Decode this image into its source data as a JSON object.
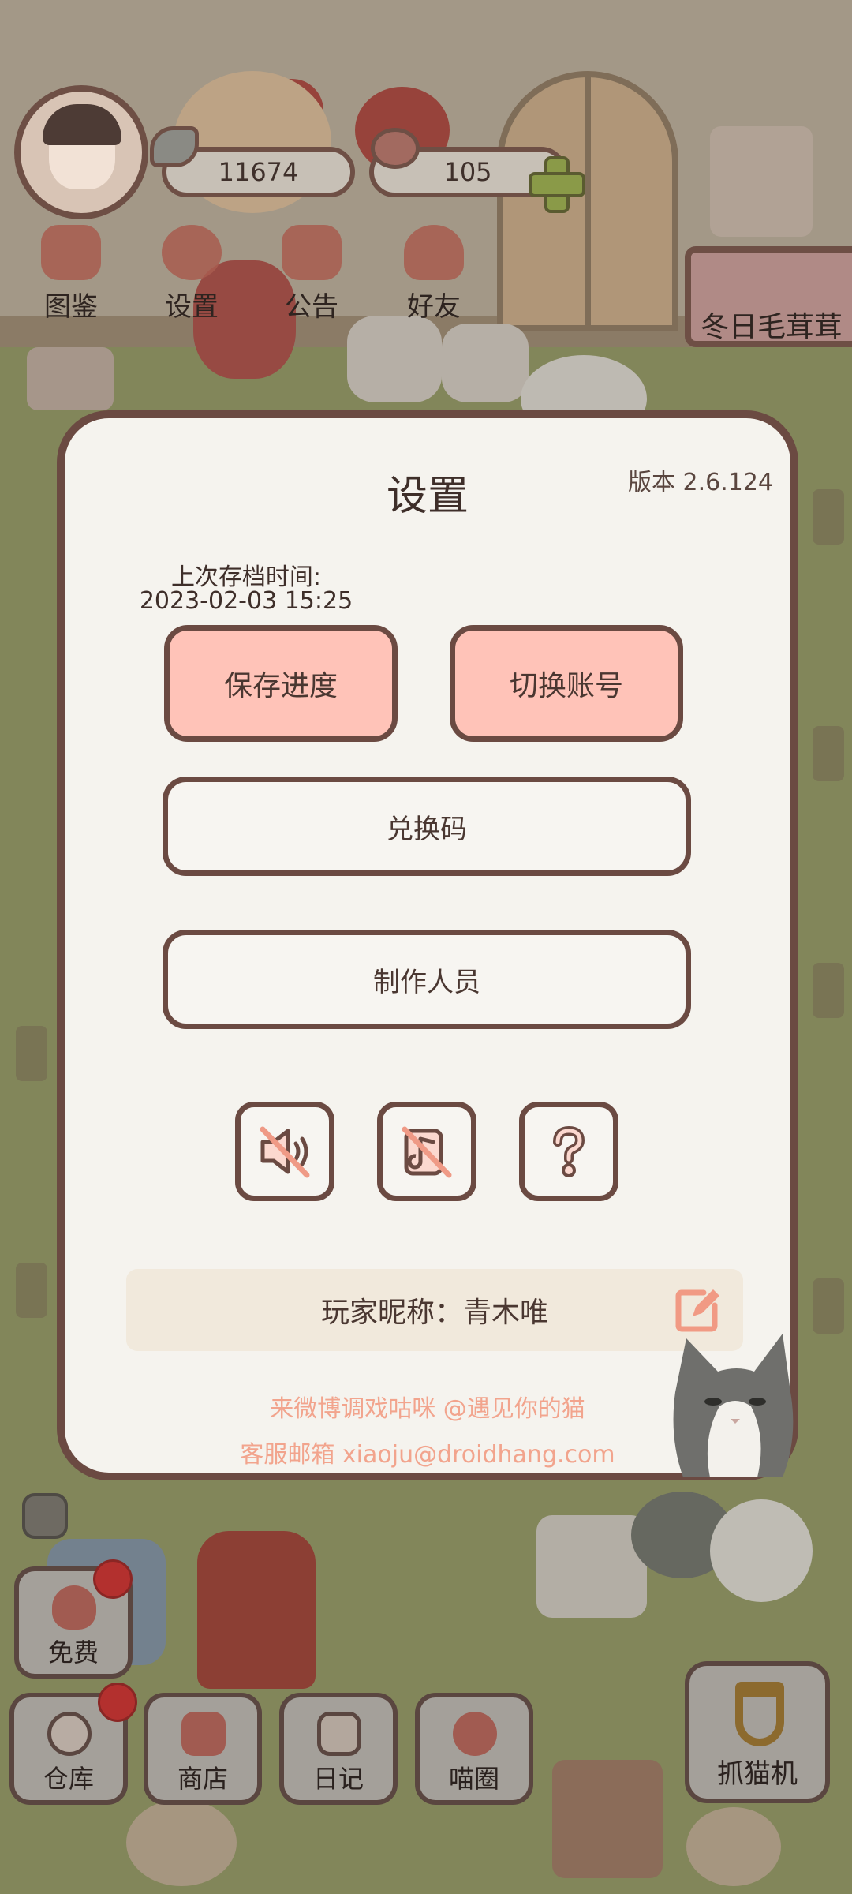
{
  "hud": {
    "coins": "11674",
    "gems": "105",
    "menu": [
      {
        "label": "图鉴",
        "icon": "cat-book-icon"
      },
      {
        "label": "设置",
        "icon": "gear-icon"
      },
      {
        "label": "公告",
        "icon": "gift-icon"
      },
      {
        "label": "好友",
        "icon": "friends-icon"
      }
    ],
    "event_label": "冬日毛茸茸",
    "bottom": [
      {
        "label": "免费",
        "icon": "heart-icon",
        "badge": true
      },
      {
        "label": "仓库",
        "icon": "bowl-icon",
        "badge": true
      },
      {
        "label": "商店",
        "icon": "shop-icon",
        "badge": false
      },
      {
        "label": "日记",
        "icon": "diary-icon",
        "badge": false
      },
      {
        "label": "喵圈",
        "icon": "cat-planet-icon",
        "badge": false
      }
    ],
    "claw_label": "抓猫机"
  },
  "settings": {
    "title": "设置",
    "version": "版本 2.6.124",
    "save_time_label": "上次存档时间:",
    "save_time_value": "2023-02-03 15:25",
    "save_button": "保存进度",
    "switch_account_button": "切换账号",
    "redeem_button": "兑换码",
    "credits_button": "制作人员",
    "nickname": "玩家昵称：青木唯",
    "weibo_text": "来微博调戏咕咪 @遇见你的猫",
    "email_text": "客服邮箱 xiaoju@droidhang.com"
  },
  "colors": {
    "accent_pink": "#ffc3b8",
    "border_brown": "#6b4a42",
    "panel_bg": "#f5f3ee",
    "contact_text": "#f2a48d",
    "badge_red": "#b3302e"
  }
}
